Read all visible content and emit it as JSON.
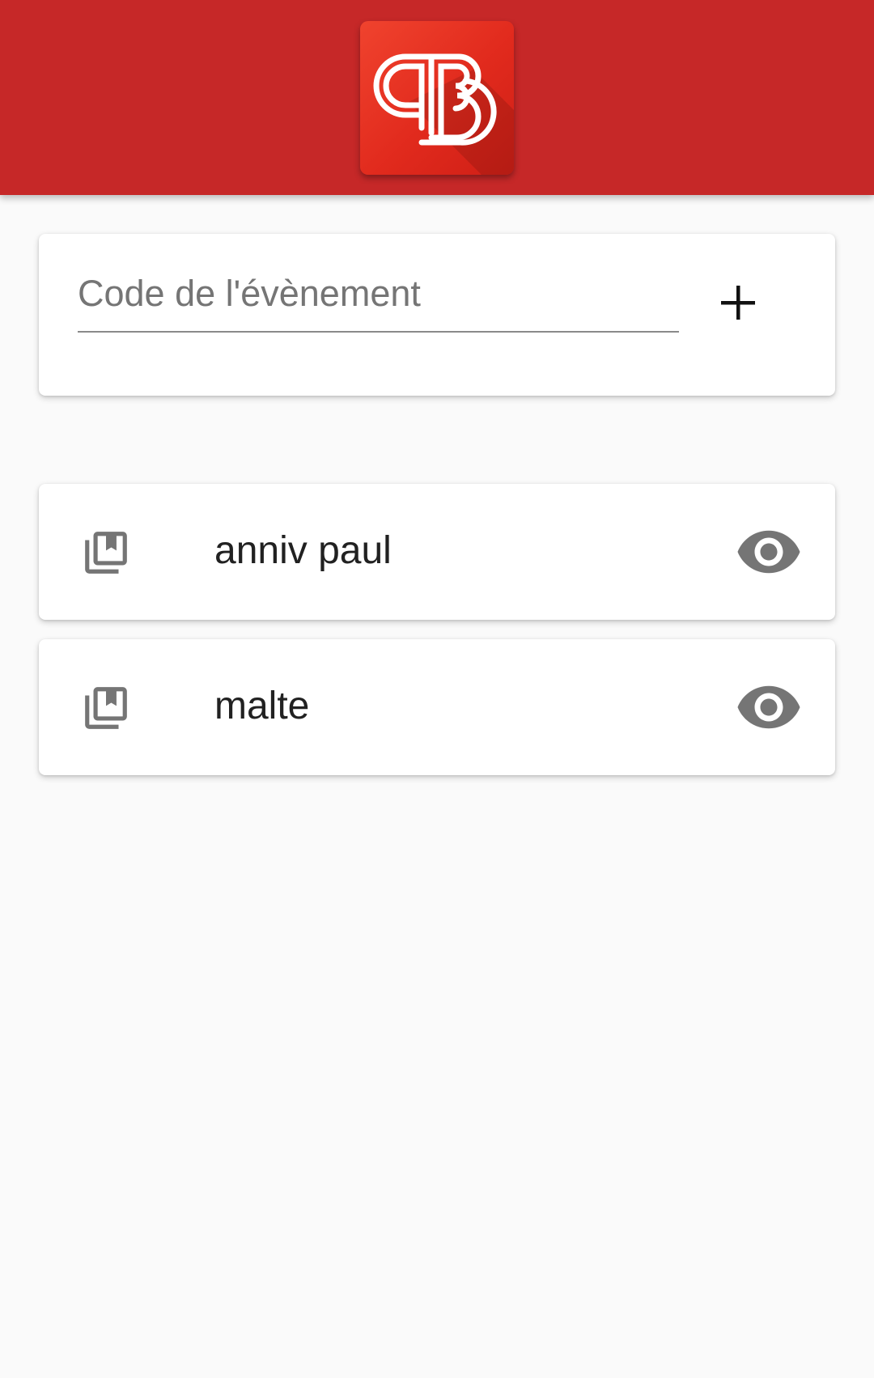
{
  "header": {
    "background_color": "#c62828",
    "logo_icon": "app-logo"
  },
  "event_code": {
    "placeholder": "Code de l'évènement",
    "value": "",
    "add_icon": "plus-icon"
  },
  "events": [
    {
      "name": "anniv paul",
      "icon": "photo-library-icon",
      "action_icon": "eye-icon"
    },
    {
      "name": "malte",
      "icon": "photo-library-icon",
      "action_icon": "eye-icon"
    }
  ],
  "colors": {
    "accent": "#c62828",
    "icon_gray": "#757575",
    "background": "#fafafa"
  }
}
